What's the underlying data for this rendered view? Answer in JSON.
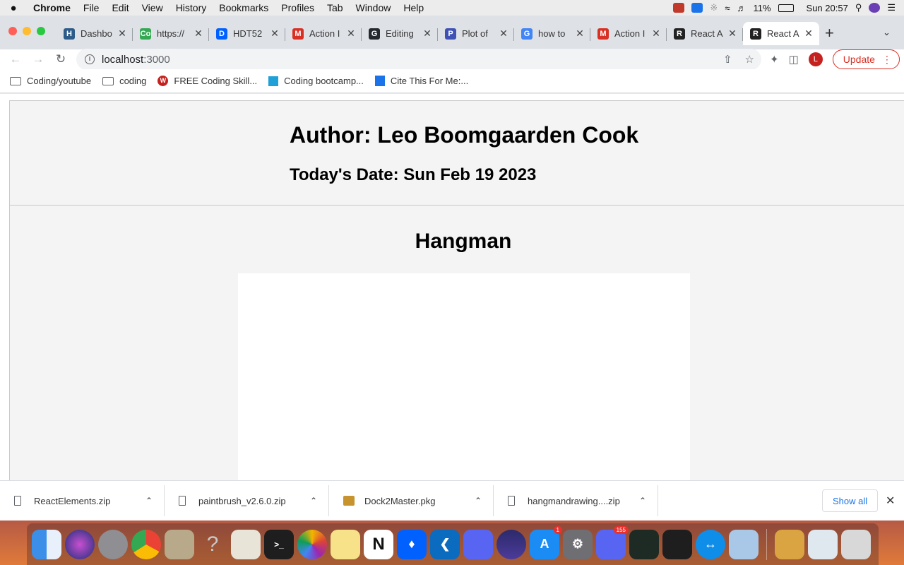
{
  "menubar": {
    "apple": "",
    "items": [
      "Chrome",
      "File",
      "Edit",
      "View",
      "History",
      "Bookmarks",
      "Profiles",
      "Tab",
      "Window",
      "Help"
    ],
    "battery": "11%",
    "clock": "Sun 20:57"
  },
  "tabs": [
    {
      "title": "Dashbo",
      "favicon": "H",
      "color": "#2d5c8a"
    },
    {
      "title": "https://",
      "favicon": "Co",
      "color": "#34a853"
    },
    {
      "title": "HDT52",
      "favicon": "D",
      "color": "#0061ff"
    },
    {
      "title": "Action I",
      "favicon": "M",
      "color": "#d93025"
    },
    {
      "title": "Editing",
      "favicon": "G",
      "color": "#24292e"
    },
    {
      "title": "Plot of",
      "favicon": "P",
      "color": "#3f51b5"
    },
    {
      "title": "how to",
      "favicon": "G",
      "color": "#4285f4"
    },
    {
      "title": "Action I",
      "favicon": "M",
      "color": "#d93025"
    },
    {
      "title": "React A",
      "favicon": "R",
      "color": "#222222"
    },
    {
      "title": "React A",
      "favicon": "R",
      "color": "#222222"
    }
  ],
  "toolbar": {
    "url_host": "localhost",
    "url_port": ":3000",
    "avatar_initial": "L",
    "update_label": "Update"
  },
  "bookmarks": [
    {
      "label": "Coding/youtube",
      "icon": "folder-icon"
    },
    {
      "label": "coding",
      "icon": "folder-icon"
    },
    {
      "label": "FREE Coding Skill...",
      "icon": "w-icon"
    },
    {
      "label": "Coding bootcamp...",
      "icon": "t-icon"
    },
    {
      "label": "Cite This For Me:...",
      "icon": "cite-icon"
    }
  ],
  "page": {
    "author": "Author: Leo Boomgaarden Cook",
    "date": "Today's Date: Sun Feb 19 2023",
    "game_title": "Hangman"
  },
  "downloads": {
    "items": [
      "ReactElements.zip",
      "paintbrush_v2.6.0.zip",
      "Dock2Master.pkg",
      "hangmandrawing....zip"
    ],
    "show_all": "Show all"
  },
  "dock": {
    "badges": {
      "app_store": "1",
      "discord": "155"
    }
  }
}
